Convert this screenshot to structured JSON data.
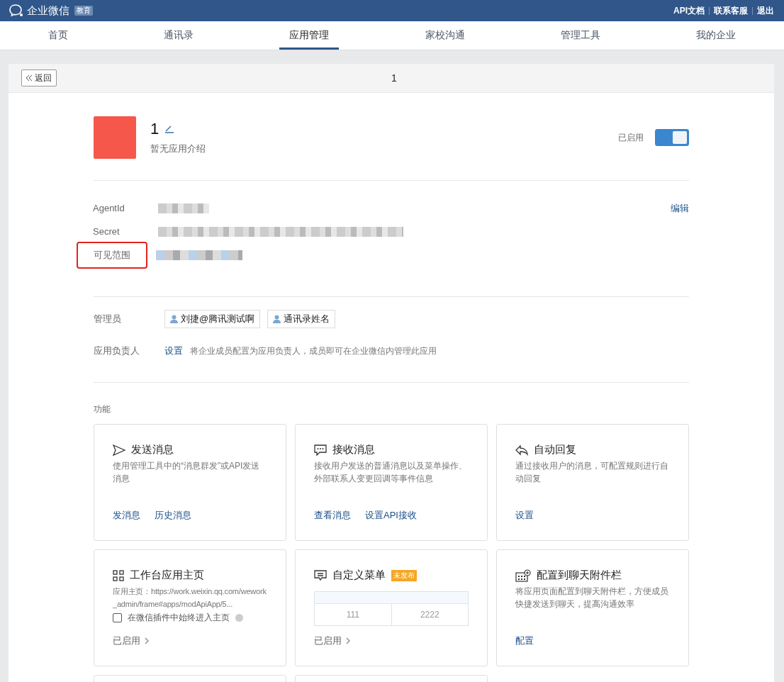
{
  "header": {
    "brand": "企业微信",
    "badge": "教育",
    "links": [
      "API文档",
      "联系客服",
      "退出"
    ]
  },
  "tabs": [
    {
      "label": "首页",
      "selected": false
    },
    {
      "label": "通讯录",
      "selected": false
    },
    {
      "label": "应用管理",
      "selected": true
    },
    {
      "label": "家校沟通",
      "selected": false
    },
    {
      "label": "管理工具",
      "selected": false
    },
    {
      "label": "我的企业",
      "selected": false
    }
  ],
  "panel": {
    "back": "返回",
    "title": "1"
  },
  "app": {
    "name": "1",
    "description": "暂无应用介绍",
    "status_label": "已启用",
    "enabled": true
  },
  "info": {
    "edit": "编辑",
    "rows": [
      {
        "label": "AgentId",
        "highlighted": false,
        "kind": "plain"
      },
      {
        "label": "Secret",
        "highlighted": false,
        "kind": "long"
      },
      {
        "label": "可见范围",
        "highlighted": true,
        "kind": "tag"
      }
    ]
  },
  "admins": {
    "label": "管理员",
    "tags": [
      "刘捷@腾讯测试啊",
      "通讯录姓名"
    ]
  },
  "owner": {
    "label": "应用负责人",
    "link": "设置",
    "hint": "将企业成员配置为应用负责人，成员即可在企业微信内管理此应用"
  },
  "features": {
    "title": "功能",
    "cards": [
      {
        "kind": "links",
        "title": "发送消息",
        "description": "使用管理工具中的“消息群发”或API发送消息",
        "links": [
          "发消息",
          "历史消息"
        ]
      },
      {
        "kind": "links",
        "title": "接收消息",
        "description": "接收用户发送的普通消息以及菜单操作、外部联系人变更回调等事件信息",
        "links": [
          "查看消息",
          "设置API接收"
        ]
      },
      {
        "kind": "links",
        "title": "自动回复",
        "description": "通过接收用户的消息，可配置规则进行自动回复",
        "links": [
          "设置"
        ]
      },
      {
        "kind": "homepage",
        "title": "工作台应用主页",
        "description": "应用主页：https://work.weixin.qq.com/wework_admin/frame#apps/modApiApp/5...",
        "checkbox": {
          "label": "在微信插件中始终进入主页",
          "checked": false
        },
        "status": "已启用"
      },
      {
        "kind": "menu",
        "title": "自定义菜单",
        "badge": "未发布",
        "menu_items": [
          "111",
          "2222"
        ],
        "status": "已启用"
      },
      {
        "kind": "links",
        "title": "配置到聊天附件栏",
        "description": "将应用页面配置到聊天附件栏，方便成员快捷发送到聊天，提高沟通效率",
        "links": [
          "配置"
        ]
      }
    ]
  }
}
